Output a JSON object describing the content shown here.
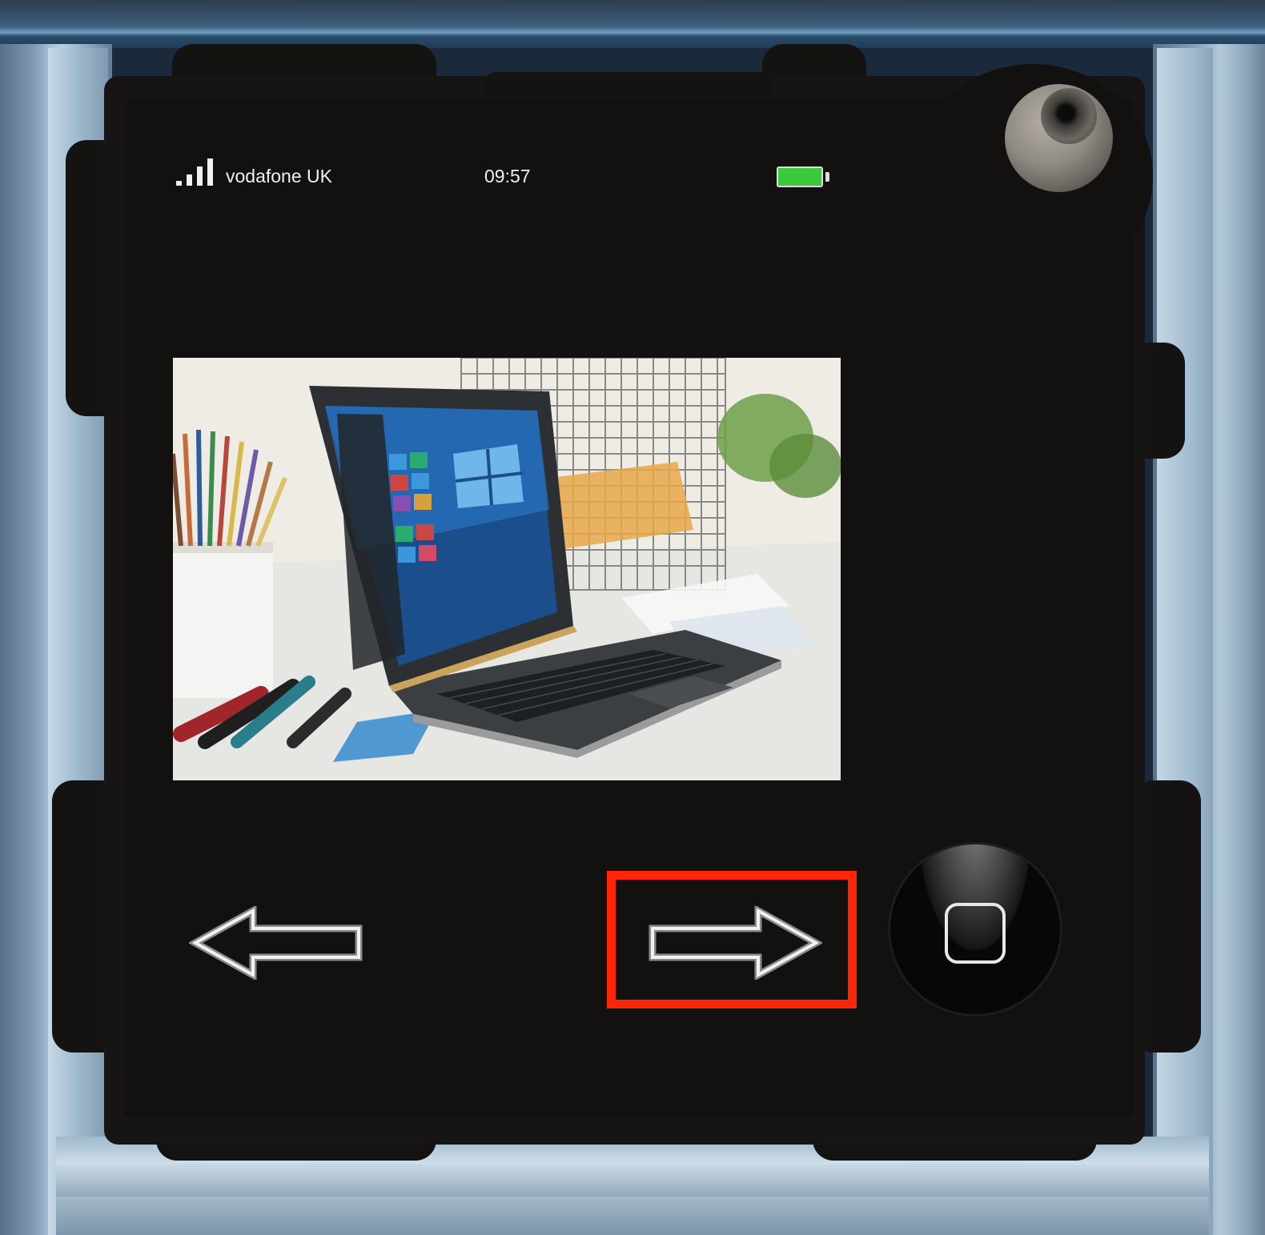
{
  "status_bar": {
    "signal_bars": 4,
    "carrier": "vodafone UK",
    "time": "09:57",
    "battery_level": 1.0
  },
  "screen": {
    "photo": {
      "subject": "laptop-on-desk-photo",
      "icon": "laptop-photo"
    }
  },
  "controls": {
    "back_arrow": "left-arrow-icon",
    "next_arrow": "right-arrow-icon",
    "home": "home-square-icon",
    "highlighted_control": "next_arrow"
  },
  "colors": {
    "highlight": "#ff2508",
    "battery_fill": "#3cc83c",
    "device_body": "#161514"
  }
}
